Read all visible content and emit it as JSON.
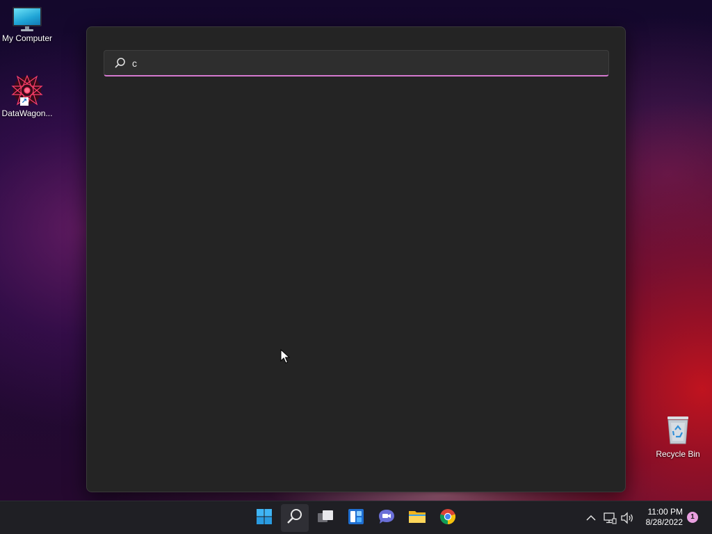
{
  "desktop": {
    "icons": [
      {
        "label": "My Computer",
        "icon": "monitor-icon"
      },
      {
        "label": "DataWagon...",
        "icon": "datawagon-icon"
      },
      {
        "label": "Recycle Bin",
        "icon": "recycle-bin-icon"
      }
    ]
  },
  "search": {
    "query": "c",
    "icon": "search-icon",
    "accent_color": "#d67ad0"
  },
  "taskbar": {
    "apps": [
      {
        "name": "Start",
        "icon": "windows-start-icon"
      },
      {
        "name": "Search",
        "icon": "search-icon",
        "active": true
      },
      {
        "name": "Task View",
        "icon": "task-view-icon"
      },
      {
        "name": "Widgets",
        "icon": "widgets-icon"
      },
      {
        "name": "Chat",
        "icon": "chat-icon"
      },
      {
        "name": "File Explorer",
        "icon": "file-explorer-icon"
      },
      {
        "name": "Google Chrome",
        "icon": "chrome-icon"
      }
    ],
    "tray": {
      "time": "11:00 PM",
      "date": "8/28/2022",
      "notification_count": "1"
    }
  }
}
